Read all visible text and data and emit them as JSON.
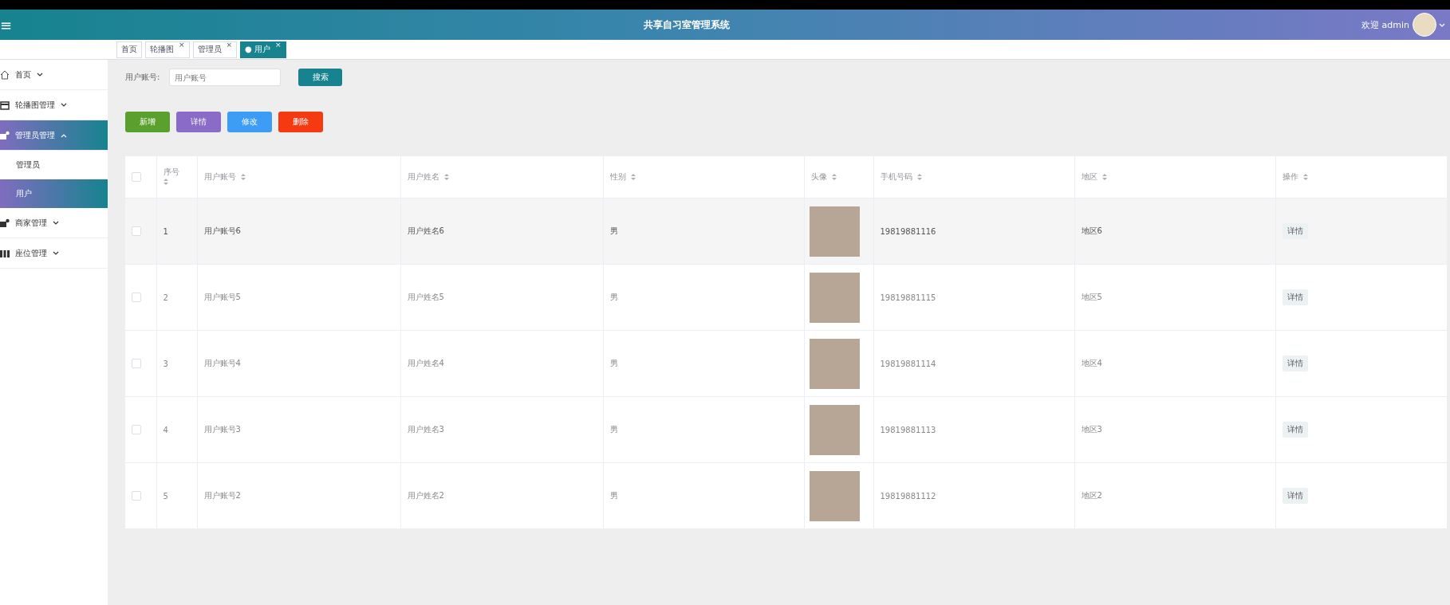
{
  "header": {
    "menu_icon": "≡",
    "title": "共享自习室管理系统",
    "welcome": "欢迎 admin"
  },
  "tabs": [
    {
      "label": "首页",
      "selected": false
    },
    {
      "label": "轮播图",
      "selected": false,
      "close": "×"
    },
    {
      "label": "管理员",
      "selected": false,
      "close": "×"
    },
    {
      "label": "用户",
      "selected": true,
      "dot": "●",
      "close": "×"
    }
  ],
  "sidebar": {
    "items": [
      {
        "label": "首页",
        "expanded": false,
        "selected": false
      },
      {
        "label": "轮播图管理",
        "expanded": false,
        "selected": false
      },
      {
        "label": "管理员管理",
        "expanded": true,
        "selected": true,
        "children": [
          {
            "label": "管理员",
            "selected": false
          },
          {
            "label": "用户",
            "selected": true
          }
        ]
      },
      {
        "label": "商家管理",
        "expanded": false,
        "selected": false
      },
      {
        "label": "座位管理",
        "expanded": false,
        "selected": false
      }
    ]
  },
  "search": {
    "label": "用户账号:",
    "placeholder": "用户账号",
    "button": "搜索"
  },
  "actions": [
    {
      "label": "新增",
      "color": "#5aa02c"
    },
    {
      "label": "详情",
      "color": "#8a6cc8"
    },
    {
      "label": "修改",
      "color": "#3d9cf5"
    },
    {
      "label": "删除",
      "color": "#f53a12"
    }
  ],
  "table": {
    "select_all_checked": false,
    "columns": [
      "序号",
      "用户账号",
      "用户姓名",
      "性别",
      "头像",
      "手机号码",
      "地区",
      "操作"
    ],
    "rows": [
      {
        "checked": false,
        "no": "1",
        "account": "用户账号6",
        "name": "用户姓名6",
        "gender": "男",
        "phone": "19819881116",
        "region": "地区6",
        "action": "详情",
        "hovered": true
      },
      {
        "checked": false,
        "no": "2",
        "account": "用户账号5",
        "name": "用户姓名5",
        "gender": "男",
        "phone": "19819881115",
        "region": "地区5",
        "action": "详情",
        "hovered": false
      },
      {
        "checked": false,
        "no": "3",
        "account": "用户账号4",
        "name": "用户姓名4",
        "gender": "男",
        "phone": "19819881114",
        "region": "地区4",
        "action": "详情",
        "hovered": false
      },
      {
        "checked": false,
        "no": "4",
        "account": "用户账号3",
        "name": "用户姓名3",
        "gender": "男",
        "phone": "19819881113",
        "region": "地区3",
        "action": "详情",
        "hovered": false
      },
      {
        "checked": false,
        "no": "5",
        "account": "用户账号2",
        "name": "用户姓名2",
        "gender": "男",
        "phone": "19819881112",
        "region": "地区2",
        "action": "详情",
        "hovered": false
      }
    ]
  }
}
